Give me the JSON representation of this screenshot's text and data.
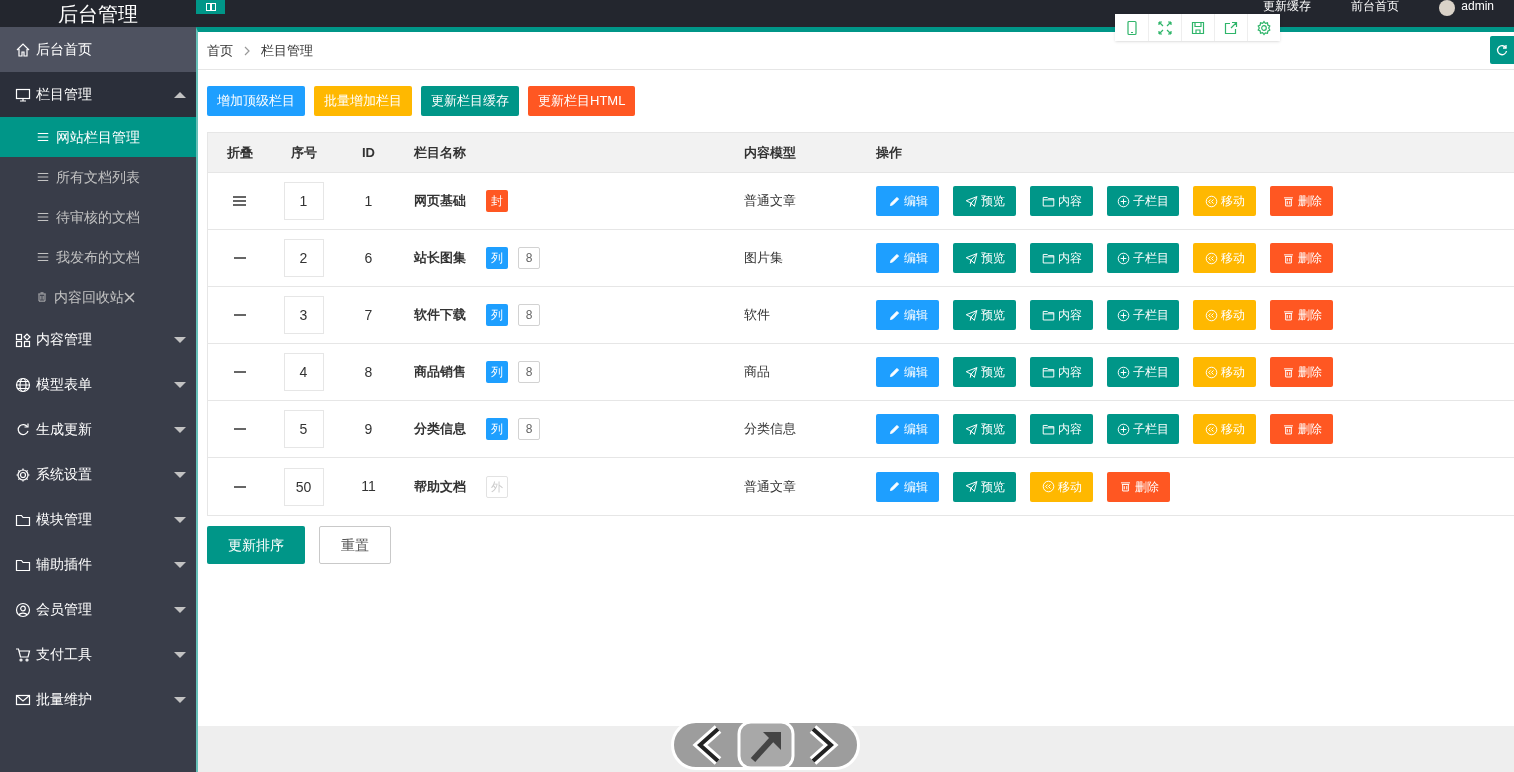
{
  "header": {
    "title": "后台管理",
    "links": [
      "更新缓存",
      "前台首页"
    ],
    "user": "admin"
  },
  "sidebar": {
    "items": [
      {
        "label": "后台首页",
        "kind": "home",
        "hovered": true
      },
      {
        "label": "栏目管理",
        "kind": "monitor",
        "expanded": true,
        "hovered": false,
        "children": [
          {
            "label": "网站栏目管理",
            "kind": "list",
            "selected": true
          },
          {
            "label": "所有文档列表",
            "kind": "list",
            "selected": false
          },
          {
            "label": "待审核的文档",
            "kind": "list",
            "selected": false
          },
          {
            "label": "我发布的文档",
            "kind": "list",
            "selected": false
          },
          {
            "label": "内容回收站",
            "kind": "trash",
            "selected": false
          }
        ]
      },
      {
        "label": "内容管理",
        "kind": "grid",
        "expanded": false,
        "hovered": false
      },
      {
        "label": "模型表单",
        "kind": "globe",
        "expanded": false,
        "hovered": false
      },
      {
        "label": "生成更新",
        "kind": "refresh",
        "expanded": false,
        "hovered": false
      },
      {
        "label": "系统设置",
        "kind": "gear",
        "expanded": false,
        "hovered": false
      },
      {
        "label": "模块管理",
        "kind": "folder",
        "expanded": false,
        "hovered": false
      },
      {
        "label": "辅助插件",
        "kind": "folder",
        "expanded": false,
        "hovered": false
      },
      {
        "label": "会员管理",
        "kind": "user",
        "expanded": false,
        "hovered": false
      },
      {
        "label": "支付工具",
        "kind": "cart",
        "expanded": false,
        "hovered": false
      },
      {
        "label": "批量维护",
        "kind": "mail",
        "expanded": false,
        "hovered": false
      }
    ]
  },
  "breadcrumb": [
    "首页",
    "栏目管理"
  ],
  "actions": [
    {
      "label": "增加顶级栏目",
      "color": "#1e9fff"
    },
    {
      "label": "批量增加栏目",
      "color": "#ffb800"
    },
    {
      "label": "更新栏目缓存",
      "color": "#009688"
    },
    {
      "label": "更新栏目HTML",
      "color": "#ff5722"
    }
  ],
  "table": {
    "columns": [
      "折叠",
      "序号",
      "ID",
      "栏目名称",
      "内容模型",
      "操作"
    ],
    "rows": [
      {
        "expanded": true,
        "order": "1",
        "id": "1",
        "name": "网页基础",
        "badges": [
          {
            "text": "封",
            "kind": "cover"
          }
        ],
        "model": "普通文章",
        "buttons": [
          {
            "label": "编辑",
            "kind": "edit"
          },
          {
            "label": "预览",
            "kind": "preview"
          },
          {
            "label": "内容",
            "kind": "content"
          },
          {
            "label": "子栏目",
            "kind": "child"
          },
          {
            "label": "移动",
            "kind": "move"
          },
          {
            "label": "删除",
            "kind": "delete"
          }
        ]
      },
      {
        "expanded": false,
        "order": "2",
        "id": "6",
        "name": "站长图集",
        "badges": [
          {
            "text": "列",
            "kind": "list"
          },
          {
            "text": "8",
            "kind": "count"
          }
        ],
        "model": "图片集",
        "buttons": [
          {
            "label": "编辑",
            "kind": "edit"
          },
          {
            "label": "预览",
            "kind": "preview"
          },
          {
            "label": "内容",
            "kind": "content"
          },
          {
            "label": "子栏目",
            "kind": "child"
          },
          {
            "label": "移动",
            "kind": "move"
          },
          {
            "label": "删除",
            "kind": "delete"
          }
        ]
      },
      {
        "expanded": false,
        "order": "3",
        "id": "7",
        "name": "软件下载",
        "badges": [
          {
            "text": "列",
            "kind": "list"
          },
          {
            "text": "8",
            "kind": "count"
          }
        ],
        "model": "软件",
        "buttons": [
          {
            "label": "编辑",
            "kind": "edit"
          },
          {
            "label": "预览",
            "kind": "preview"
          },
          {
            "label": "内容",
            "kind": "content"
          },
          {
            "label": "子栏目",
            "kind": "child"
          },
          {
            "label": "移动",
            "kind": "move"
          },
          {
            "label": "删除",
            "kind": "delete"
          }
        ]
      },
      {
        "expanded": false,
        "order": "4",
        "id": "8",
        "name": "商品销售",
        "badges": [
          {
            "text": "列",
            "kind": "list"
          },
          {
            "text": "8",
            "kind": "count"
          }
        ],
        "model": "商品",
        "buttons": [
          {
            "label": "编辑",
            "kind": "edit"
          },
          {
            "label": "预览",
            "kind": "preview"
          },
          {
            "label": "内容",
            "kind": "content"
          },
          {
            "label": "子栏目",
            "kind": "child"
          },
          {
            "label": "移动",
            "kind": "move"
          },
          {
            "label": "删除",
            "kind": "delete"
          }
        ]
      },
      {
        "expanded": false,
        "order": "5",
        "id": "9",
        "name": "分类信息",
        "badges": [
          {
            "text": "列",
            "kind": "list"
          },
          {
            "text": "8",
            "kind": "count"
          }
        ],
        "model": "分类信息",
        "buttons": [
          {
            "label": "编辑",
            "kind": "edit"
          },
          {
            "label": "预览",
            "kind": "preview"
          },
          {
            "label": "内容",
            "kind": "content"
          },
          {
            "label": "子栏目",
            "kind": "child"
          },
          {
            "label": "移动",
            "kind": "move"
          },
          {
            "label": "删除",
            "kind": "delete"
          }
        ]
      },
      {
        "expanded": false,
        "order": "50",
        "id": "11",
        "name": "帮助文档",
        "badges": [
          {
            "text": "外",
            "kind": "external"
          }
        ],
        "model": "普通文章",
        "buttons": [
          {
            "label": "编辑",
            "kind": "edit"
          },
          {
            "label": "预览",
            "kind": "preview"
          },
          {
            "label": "移动",
            "kind": "move"
          },
          {
            "label": "删除",
            "kind": "delete"
          }
        ]
      }
    ]
  },
  "footer_buttons": [
    {
      "label": "更新排序",
      "kind": "primary"
    },
    {
      "label": "重置",
      "kind": "plain"
    }
  ]
}
